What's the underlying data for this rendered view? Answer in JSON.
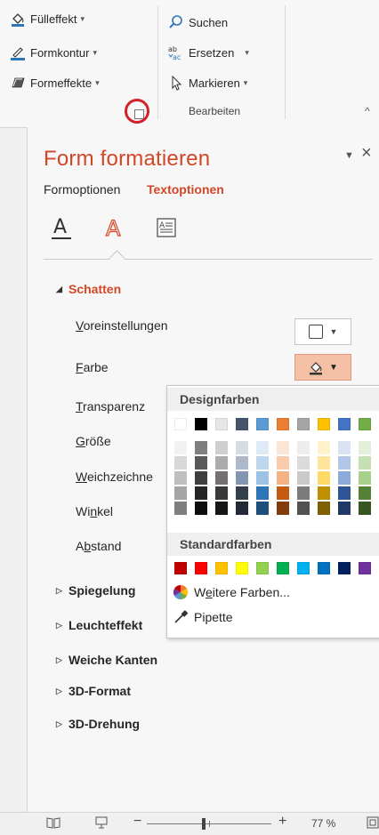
{
  "ribbon": {
    "fill_effect": "Fülleffekt",
    "shape_outline": "Formkontur",
    "shape_effects": "Formeffekte",
    "search": "Suchen",
    "replace": "Ersetzen",
    "select": "Markieren",
    "group_edit": "Bearbeiten"
  },
  "pane": {
    "title": "Form formatieren",
    "tab_shape_options": "Formoptionen",
    "tab_text_options": "Textoptionen",
    "sections": {
      "shadow": "Schatten",
      "reflection": "Spiegelung",
      "glow": "Leuchteffekt",
      "soft_edges": "Weiche Kanten",
      "format_3d": "3D-Format",
      "rotation_3d": "3D-Drehung"
    },
    "shadow_props": {
      "presets": {
        "first": "V",
        "rest": "oreinstellungen"
      },
      "color": {
        "first": "F",
        "rest": "arbe"
      },
      "transparency": {
        "first": "T",
        "rest": "ransparenz"
      },
      "size": {
        "first": "G",
        "rest": "röße"
      },
      "blur": {
        "first": "W",
        "rest": "eichzeichne"
      },
      "angle": {
        "pre": "Wi",
        "u": "n",
        "post": "kel"
      },
      "distance": {
        "pre": "A",
        "u": "b",
        "post": "stand"
      }
    }
  },
  "palette": {
    "theme_colors_label": "Designfarben",
    "standard_colors_label": "Standardfarben",
    "more_colors": {
      "pre": "W",
      "u": "e",
      "post": "itere Farben..."
    },
    "eyedropper": "Pipette",
    "theme_top": [
      "#ffffff",
      "#000000",
      "#e7e6e6",
      "#44546a",
      "#5b9bd5",
      "#ed7d31",
      "#a5a5a5",
      "#ffc000",
      "#4472c4",
      "#70ad47"
    ],
    "theme_shades": [
      [
        "#f2f2f2",
        "#7f7f7f",
        "#d0cece",
        "#d6dce4",
        "#deebf6",
        "#fbe5d5",
        "#ededed",
        "#fff2cc",
        "#dae3f3",
        "#e2efd9"
      ],
      [
        "#d8d8d8",
        "#595959",
        "#aeabab",
        "#adb9ca",
        "#bdd7ee",
        "#f7cbac",
        "#dbdbdb",
        "#fee599",
        "#b4c6e7",
        "#c5e0b3"
      ],
      [
        "#bfbfbf",
        "#3f3f3f",
        "#757070",
        "#8496b0",
        "#9cc3e5",
        "#f4b183",
        "#c9c9c9",
        "#ffd965",
        "#8eaadb",
        "#a8d08d"
      ],
      [
        "#a5a5a5",
        "#262626",
        "#3a3838",
        "#323f4f",
        "#2e75b5",
        "#c55a11",
        "#7b7b7b",
        "#bf9000",
        "#2f5496",
        "#538135"
      ],
      [
        "#7f7f7f",
        "#0c0c0c",
        "#171616",
        "#222a35",
        "#1e4e79",
        "#833c0b",
        "#525252",
        "#7f6000",
        "#1f3864",
        "#375623"
      ]
    ],
    "standard": [
      "#c00000",
      "#ff0000",
      "#ffc000",
      "#ffff00",
      "#92d050",
      "#00b050",
      "#00b0f0",
      "#0070c0",
      "#002060",
      "#7030a0"
    ]
  },
  "status": {
    "zoom_minus": "−",
    "zoom_plus": "+",
    "zoom_level": "77 %"
  },
  "colors": {
    "accent": "#d24726",
    "highlight_circle": "#d4202a"
  }
}
